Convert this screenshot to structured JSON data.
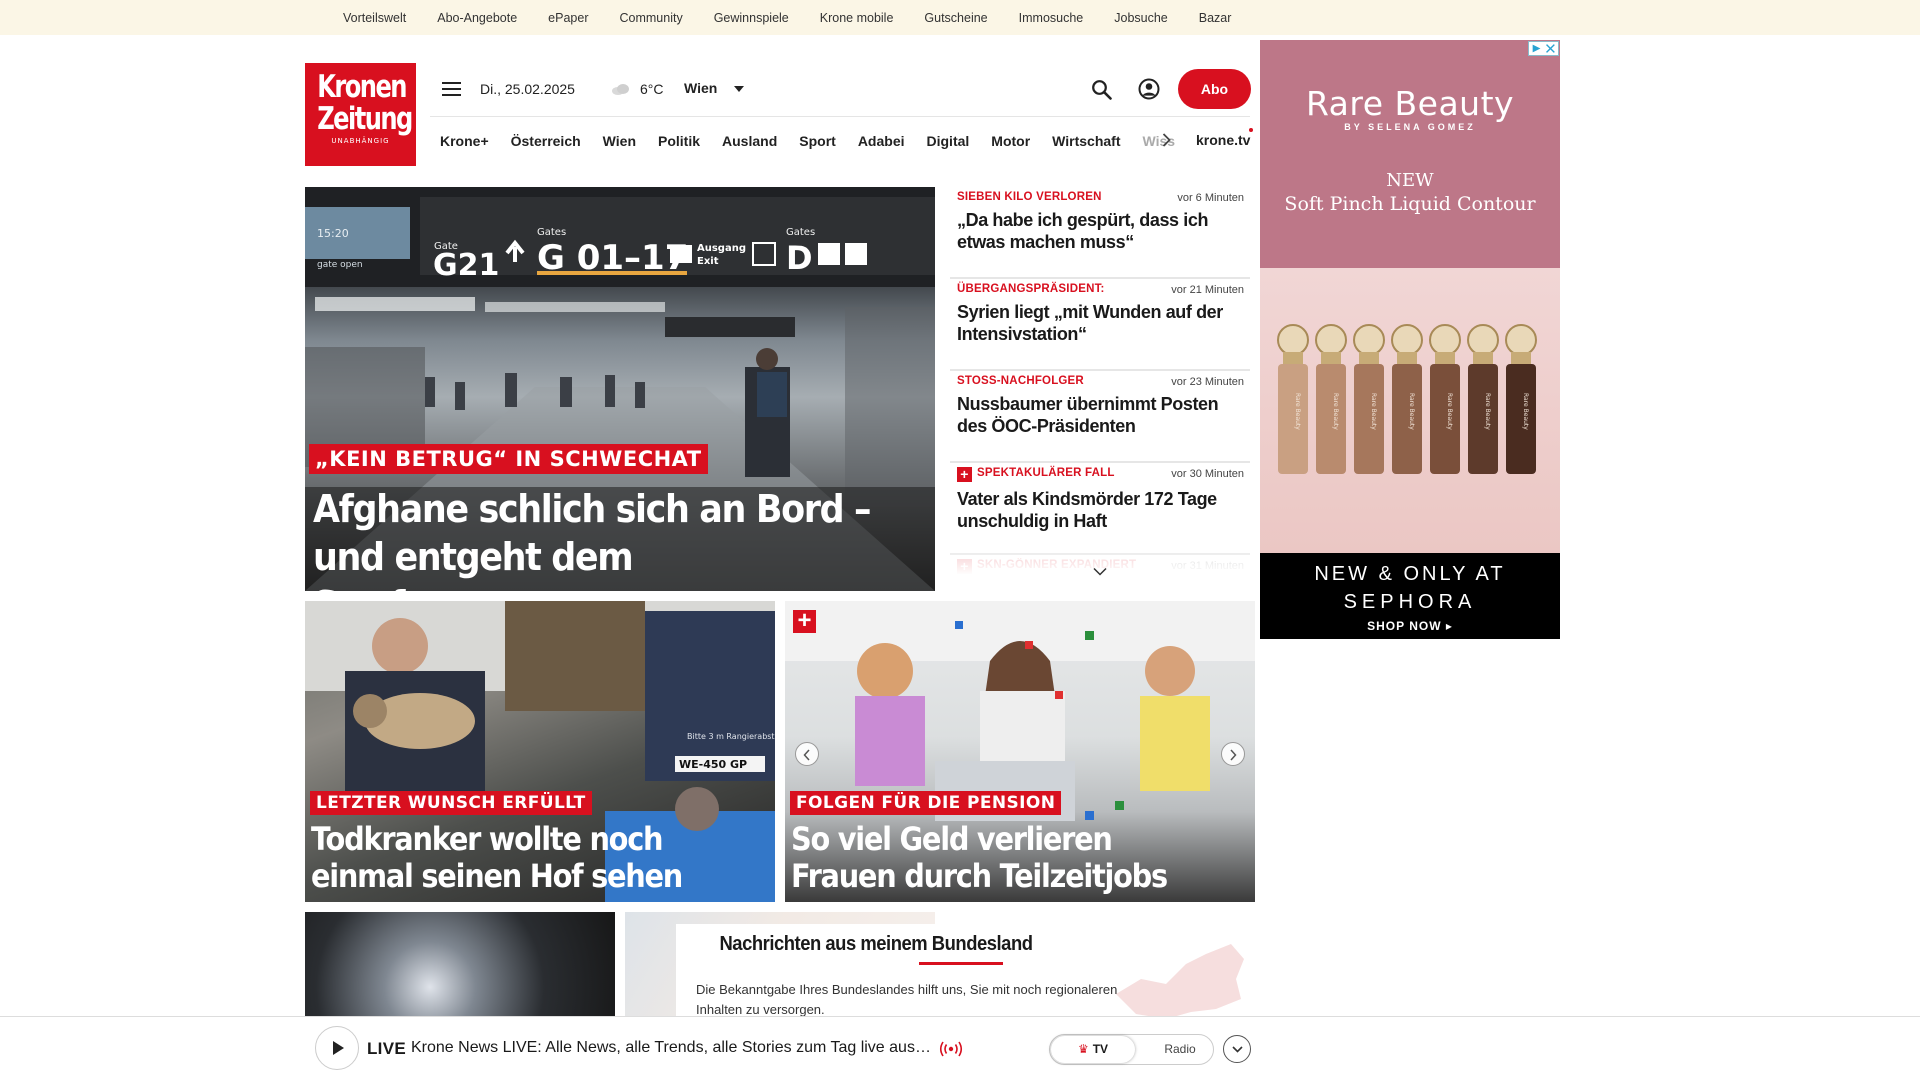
{
  "topbar": {
    "links": [
      "Vorteilswelt",
      "Abo-Angebote",
      "ePaper",
      "Community",
      "Gewinnspiele",
      "Krone mobile",
      "Gutscheine",
      "Immosuche",
      "Jobsuche",
      "Bazar"
    ]
  },
  "header": {
    "logo_line1": "Kronen",
    "logo_line2": "Zeitung",
    "logo_tagline": "UNABHÄNGIG",
    "date": "Di., 25.02.2025",
    "temperature": "6°C",
    "city": "Wien",
    "abo_label": "Abo"
  },
  "nav": {
    "items": [
      "Krone+",
      "Österreich",
      "Wien",
      "Politik",
      "Ausland",
      "Sport",
      "Adabei",
      "Digital",
      "Motor",
      "Wirtschaft"
    ],
    "partial_item": "Wiss",
    "tv_label": "krone.tv"
  },
  "hero": {
    "kicker": "„KEIN BETRUG“ IN SCHWECHAT",
    "headline": "Afghane schlich sich an Bord – und entgeht dem Strafprozess",
    "sign_gate": "G21",
    "sign_gates": "G 01–17",
    "sign_exit": "Ausgang Exit",
    "sign_d": "D",
    "sign_time": "15:20",
    "sign_gate_open": "gate open",
    "sign_label_gate": "Gate",
    "sign_label_gates": "Gates",
    "sign_label_gates2": "Gates"
  },
  "news_list": [
    {
      "kicker": "SIEBEN KILO VERLOREN",
      "time": "vor 6 Minuten",
      "title": "„Da habe ich gespürt, dass ich etwas machen muss“",
      "plus": false
    },
    {
      "kicker": "ÜBERGANGSPRÄSIDENT:",
      "time": "vor 21 Minuten",
      "title": "Syrien liegt „mit Wunden auf der Intensivstation“",
      "plus": false
    },
    {
      "kicker": "STOSS-NACHFOLGER",
      "time": "vor 23 Minuten",
      "title": "Nussbaumer übernimmt Posten des ÖOC-Präsidenten",
      "plus": false
    },
    {
      "kicker": "SPEKTAKULÄRER FALL",
      "time": "vor 30 Minuten",
      "title": "Vater als Kindsmörder 172 Tage unschuldig in Haft",
      "plus": true
    },
    {
      "kicker": "SKN-GÖNNER EXPANDIERT",
      "time": "vor 31 Minuten",
      "title": "",
      "plus": true
    }
  ],
  "ad": {
    "brand": "Rare Beauty",
    "brand_sub": "BY SELENA GOMEZ",
    "new_label": "NEW",
    "product": "Soft Pinch Liquid Contour",
    "cta_line1": "NEW & ONLY AT",
    "cta_line2": "SEPHORA",
    "cta_shop": "SHOP NOW ▸",
    "bottle_label": "Rare Beauty",
    "bottle_colors": [
      "#c9a082",
      "#b98b6e",
      "#a6775c",
      "#8e6149",
      "#7a4f3a",
      "#5d3a2b",
      "#4a2c20"
    ]
  },
  "tiles": [
    {
      "kicker": "LETZTER WUNSCH ERFÜLLT",
      "headline": "Todkranker wollte noch einmal seinen Hof sehen",
      "plate": "WE-450 GP",
      "sign": "Bitte 3 m Rangierabst.",
      "plus": false
    },
    {
      "kicker": "FOLGEN FÜR DIE PENSION",
      "headline": "So viel Geld verlieren Frauen durch Teilzeitjobs",
      "plus": true
    }
  ],
  "bundesland": {
    "title": "Nachrichten aus meinem Bundesland",
    "text": "Die Bekanntgabe Ihres Bundeslandes hilft uns, Sie mit noch regionaleren Inhalten zu versorgen."
  },
  "live": {
    "label": "LIVE",
    "title": "Krone News LIVE: Alle News, alle Trends, alle Stories zum Tag live aus d...",
    "tv_label": "TV",
    "radio_label": "Radio"
  },
  "colors": {
    "brand_red": "#d8101f",
    "topbar_bg": "#fbf6e6"
  }
}
